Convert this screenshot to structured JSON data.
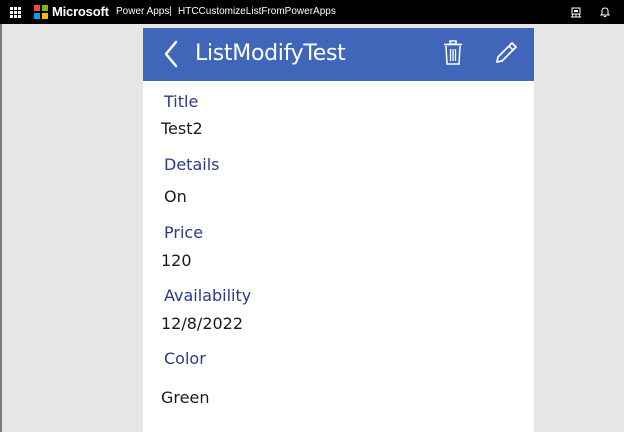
{
  "header": {
    "brand": "Microsoft",
    "app_name": "Power Apps",
    "separator": "|",
    "app_title": "HTCCustomizeListFromPowerApps",
    "colors": {
      "logo_red": "#f25022",
      "logo_green": "#7fba00",
      "logo_blue": "#00a4ef",
      "logo_yellow": "#ffb900"
    },
    "icons": [
      "waffle-icon",
      "microsoft-logo",
      "environment-icon",
      "bell-icon"
    ]
  },
  "screen": {
    "title": "ListModifyTest",
    "accent": "#3f66b8",
    "icons": [
      "back-chevron-icon",
      "trash-icon",
      "edit-pencil-icon"
    ]
  },
  "fields": [
    {
      "label": "Title",
      "value": "Test2"
    },
    {
      "label": "Details",
      "value": "On"
    },
    {
      "label": "Price",
      "value": "120"
    },
    {
      "label": "Availability",
      "value": "12/8/2022"
    },
    {
      "label": "Color",
      "value": "Green"
    }
  ]
}
